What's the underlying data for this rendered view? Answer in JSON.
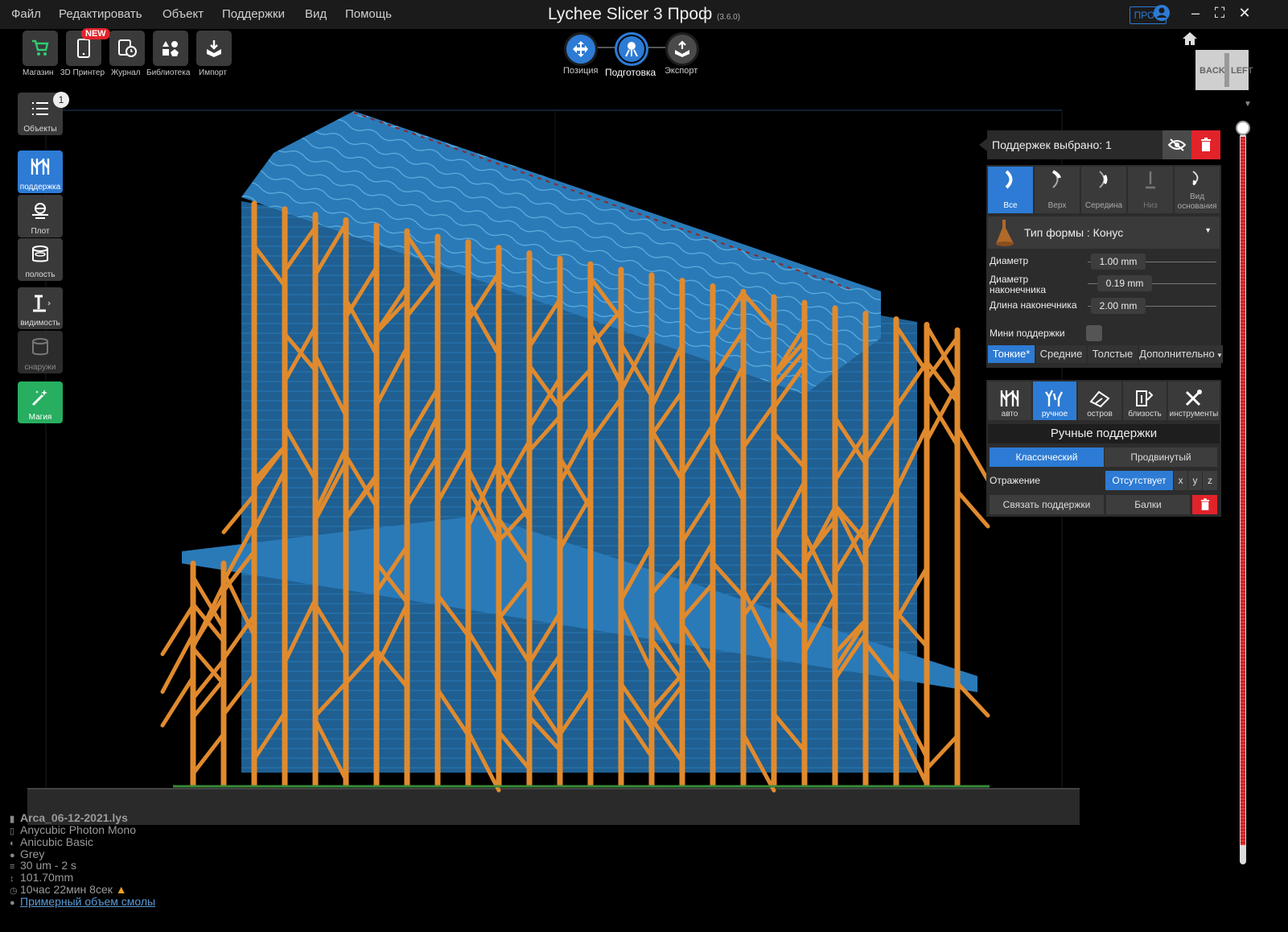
{
  "menu": [
    "Файл",
    "Редактировать",
    "Объект",
    "Поддержки",
    "Вид",
    "Помощь"
  ],
  "app": {
    "title": "Lychee Slicer 3 Проф",
    "version": "(3.6.0)",
    "pro_badge": "ПРОФ"
  },
  "window_controls": {
    "minimize": "–",
    "maximize": "⛶",
    "close": "✕"
  },
  "toolbar": {
    "new_badge": "NEW",
    "items": [
      {
        "label": "Магазин",
        "icon": "cart-icon"
      },
      {
        "label": "3D Принтер",
        "icon": "printer-phone-icon"
      },
      {
        "label": "Журнал",
        "icon": "journal-icon"
      },
      {
        "label": "Библиотека",
        "icon": "library-icon"
      },
      {
        "label": "Импорт",
        "icon": "import-icon"
      }
    ]
  },
  "steps": [
    {
      "label": "Позиция",
      "icon": "move-icon"
    },
    {
      "label": "Подготовка",
      "icon": "support-icon",
      "active": true
    },
    {
      "label": "Экспорт",
      "icon": "export-icon"
    }
  ],
  "view_cube": {
    "back": "BACK",
    "left": "LEFT"
  },
  "left_panel": {
    "objects": {
      "label": "Объекты",
      "count": "1"
    },
    "items": [
      {
        "label": "поддержка",
        "active": true
      },
      {
        "label": "Плот"
      },
      {
        "label": "полость"
      },
      {
        "label": "видимость"
      },
      {
        "label": "снаружи",
        "disabled": true
      },
      {
        "label": "Магия",
        "accent": "#27ae60"
      }
    ]
  },
  "right_panel": {
    "selected_text": "Поддержек выбрано: 1",
    "sub_tabs": [
      {
        "label": "Все",
        "active": true
      },
      {
        "label": "Верх"
      },
      {
        "label": "Середина"
      },
      {
        "label": "Низ"
      },
      {
        "label": "Вид основания"
      }
    ],
    "shape_type": "Тип формы : Конус",
    "sliders": [
      {
        "label": "Диаметр",
        "value": "1.00 mm"
      },
      {
        "label": "Диаметр наконечника",
        "value": "0.19 mm"
      },
      {
        "label": "Длина наконечника",
        "value": "2.00 mm"
      }
    ],
    "mini_supports": "Мини поддержки",
    "sizes": [
      "Тонкие*",
      "Средние",
      "Толстые",
      "Дополнительно"
    ],
    "modes": [
      {
        "label": "авто"
      },
      {
        "label": "ручное",
        "active": true
      },
      {
        "label": "остров"
      },
      {
        "label": "близость"
      },
      {
        "label": "инструменты"
      }
    ],
    "manual_title": "Ручные поддержки",
    "styles": [
      "Классический",
      "Продвинутый"
    ],
    "mirror_label": "Отражение",
    "mirror_value": "Отсутствует",
    "axes": [
      "x",
      "y",
      "z"
    ],
    "link_supports": "Связать поддержки",
    "beams": "Балки"
  },
  "info": {
    "file": "Arca_06-12-2021.lys",
    "printer": "Anycubic Photon Mono",
    "resin": "Anicubic Basic",
    "color": "Grey",
    "layers": "30 um - 2 s",
    "height": "101.70mm",
    "time": "10час 22мин 8сек",
    "resin_volume": "Примерный объем смолы"
  },
  "colors": {
    "accent": "#2d7bd4",
    "support": "#e08a2e",
    "model": "#2a7ab8",
    "delete": "#e3232a",
    "magic": "#27ae60"
  }
}
